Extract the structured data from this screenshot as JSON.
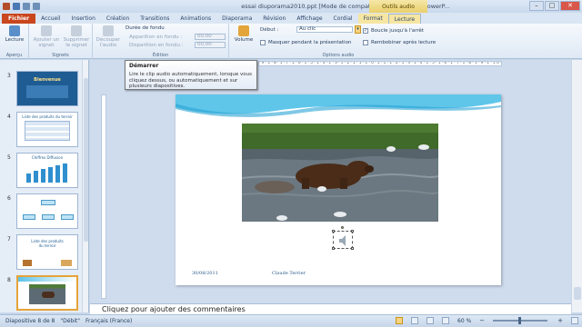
{
  "titlebar": {
    "document_title": "essai diuporama2010.ppt [Mode de compatibilité] - Microsoft PowerP...",
    "context_title": "Outils audio"
  },
  "tabs": [
    "Fichier",
    "Accueil",
    "Insertion",
    "Création",
    "Transitions",
    "Animations",
    "Diaporama",
    "Révision",
    "Affichage",
    "Cordial",
    "Format",
    "Lecture"
  ],
  "ribbon": {
    "apercu": {
      "play_label": "Lecture",
      "group": "Aperçu"
    },
    "signets": {
      "add_label": "Ajouter un signet",
      "remove_label": "Supprimer le signet",
      "group": "Signets"
    },
    "edition": {
      "trim_label": "Découper l'audio",
      "fade_title": "Durée de fondu",
      "fade_in_label": "Apparition en fondu :",
      "fade_in_value": "00,00",
      "fade_out_label": "Disparition en fondu :",
      "fade_out_value": "00,00",
      "group": "Édition"
    },
    "options": {
      "volume_label": "Volume",
      "start_label": "Début :",
      "start_value": "Au clic",
      "hide_label": "Masquer pendant la présentation",
      "loop_label": "Boucle jusqu'à l'arrêt",
      "rewind_label": "Rembobiner après lecture",
      "group": "Options audio"
    }
  },
  "tooltip": {
    "title": "Démarrer",
    "body": "Lire le clip audio automatiquement, lorsque vous cliquez dessus, ou automatiquement et sur plusieurs diapositives."
  },
  "thumbnails": [
    {
      "num": "3",
      "title": "Bienvenue"
    },
    {
      "num": "4",
      "title": "Liste des produits du terroir"
    },
    {
      "num": "5",
      "title": "Chiffres Diffusion"
    },
    {
      "num": "6",
      "title": ""
    },
    {
      "num": "7",
      "title": "Liste des produits du terroir"
    },
    {
      "num": "8",
      "title": ""
    }
  ],
  "ruler_text": "·9·1·8·1·7·1·6·1·5·1·4·1·3·1·2·1·1·1·0·1·1·1·2·1·3·1·4·1·5·1·6·1·7·1·8·1·9·1·10·1·11·1·12·",
  "slide": {
    "date": "30/08/2011",
    "footer": "Claude Terrier"
  },
  "notes_placeholder": "Cliquez pour ajouter des commentaires",
  "statusbar": {
    "slide_info": "Diapositive 8 de 8",
    "theme": "\"Débit\"",
    "language": "Français (France)",
    "zoom": "60 %"
  },
  "colors": {
    "file_tab": "#c9461e",
    "context_tab": "#f6e6a2",
    "selection": "#e6a33a"
  }
}
